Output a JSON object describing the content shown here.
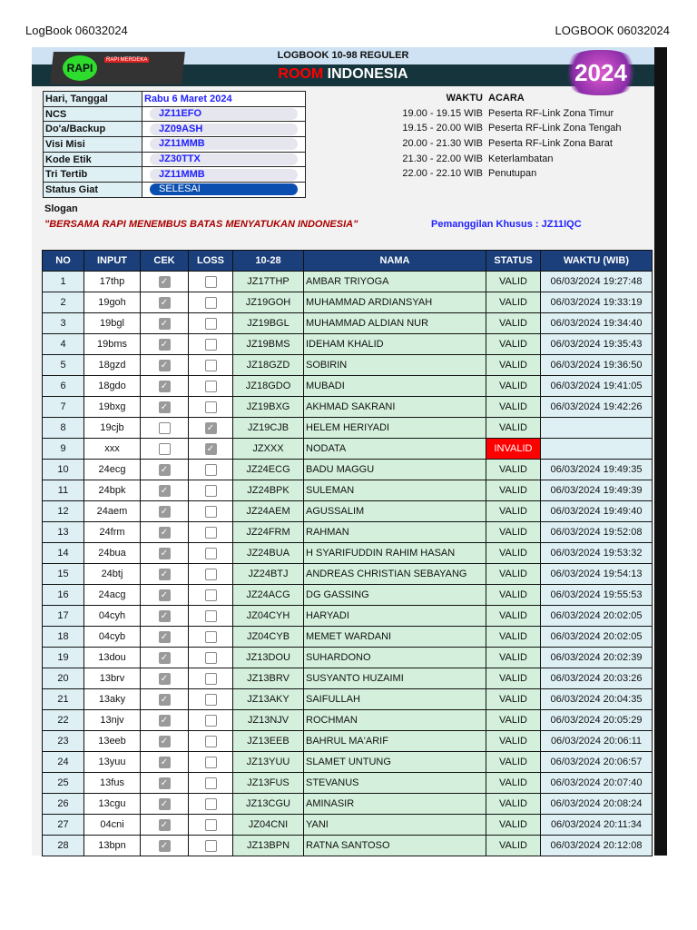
{
  "page_header": {
    "left": "LogBook 06032024",
    "right": "LOGBOOK 06032024"
  },
  "banner": {
    "title": "LOGBOOK 10-98 REGULER",
    "room_red": "ROOM",
    "room_white": "INDONESIA",
    "logo_text": "RAPI",
    "logo_sub": "RAPI MERDEKA",
    "year_badge": "2024"
  },
  "info": [
    {
      "label": "Hari, Tanggal",
      "value": "Rabu 6 Maret 2024"
    },
    {
      "label": "NCS",
      "value": "JZ11EFO"
    },
    {
      "label": "Do'a/Backup",
      "value": "JZ09ASH"
    },
    {
      "label": "Visi Misi",
      "value": "JZ11MMB"
    },
    {
      "label": "Kode Etik",
      "value": "JZ30TTX"
    },
    {
      "label": "Tri Tertib",
      "value": "JZ11MMB"
    },
    {
      "label": "Status Giat",
      "value": "SELESAI"
    }
  ],
  "schedule": {
    "header_time": "WAKTU",
    "header_event": "ACARA",
    "items": [
      {
        "time": "19.00 - 19.15 WIB",
        "event": "Peserta RF-Link Zona Timur"
      },
      {
        "time": "19.15 - 20.00 WIB",
        "event": "Peserta RF-Link Zona Tengah"
      },
      {
        "time": "20.00 - 21.30 WIB",
        "event": "Peserta RF-Link Zona Barat"
      },
      {
        "time": "21.30 - 22.00 WIB",
        "event": "Keterlambatan"
      },
      {
        "time": "22.00 - 22.10 WIB",
        "event": "Penutupan"
      }
    ]
  },
  "slogan": {
    "label": "Slogan",
    "text": "\"BERSAMA RAPI MENEMBUS BATAS MENYATUKAN INDONESIA\"",
    "special_call": "Pemanggilan Khusus   :  JZ11IQC"
  },
  "colors": {
    "header": "#1a3f7a",
    "invalid": "#ff0000",
    "green": "#d4f0dc"
  },
  "table": {
    "headers": [
      "NO",
      "INPUT",
      "CEK",
      "LOSS",
      "10-28",
      "NAMA",
      "STATUS",
      "WAKTU (WIB)"
    ],
    "rows": [
      [
        "1",
        "17thp",
        true,
        false,
        "JZ17THP",
        "AMBAR TRIYOGA",
        "VALID",
        "06/03/2024 19:27:48"
      ],
      [
        "2",
        "19goh",
        true,
        false,
        "JZ19GOH",
        "MUHAMMAD ARDIANSYAH",
        "VALID",
        "06/03/2024 19:33:19"
      ],
      [
        "3",
        "19bgl",
        true,
        false,
        "JZ19BGL",
        "MUHAMMAD ALDIAN NUR",
        "VALID",
        "06/03/2024 19:34:40"
      ],
      [
        "4",
        "19bms",
        true,
        false,
        "JZ19BMS",
        "IDEHAM KHALID",
        "VALID",
        "06/03/2024 19:35:43"
      ],
      [
        "5",
        "18gzd",
        true,
        false,
        "JZ18GZD",
        "SOBIRIN",
        "VALID",
        "06/03/2024 19:36:50"
      ],
      [
        "6",
        "18gdo",
        true,
        false,
        "JZ18GDO",
        "MUBADI",
        "VALID",
        "06/03/2024 19:41:05"
      ],
      [
        "7",
        "19bxg",
        true,
        false,
        "JZ19BXG",
        "AKHMAD SAKRANI",
        "VALID",
        "06/03/2024 19:42:26"
      ],
      [
        "8",
        "19cjb",
        false,
        true,
        "JZ19CJB",
        "HELEM HERIYADI",
        "VALID",
        ""
      ],
      [
        "9",
        "xxx",
        false,
        true,
        "JZXXX",
        "NODATA",
        "INVALID",
        ""
      ],
      [
        "10",
        "24ecg",
        true,
        false,
        "JZ24ECG",
        "BADU MAGGU",
        "VALID",
        "06/03/2024 19:49:35"
      ],
      [
        "11",
        "24bpk",
        true,
        false,
        "JZ24BPK",
        "SULEMAN",
        "VALID",
        "06/03/2024 19:49:39"
      ],
      [
        "12",
        "24aem",
        true,
        false,
        "JZ24AEM",
        "AGUSSALIM",
        "VALID",
        "06/03/2024 19:49:40"
      ],
      [
        "13",
        "24frm",
        true,
        false,
        "JZ24FRM",
        "RAHMAN",
        "VALID",
        "06/03/2024 19:52:08"
      ],
      [
        "14",
        "24bua",
        true,
        false,
        "JZ24BUA",
        "H SYARIFUDDIN RAHIM HASAN",
        "VALID",
        "06/03/2024 19:53:32"
      ],
      [
        "15",
        "24btj",
        true,
        false,
        "JZ24BTJ",
        "ANDREAS CHRISTIAN SEBAYANG",
        "VALID",
        "06/03/2024 19:54:13"
      ],
      [
        "16",
        "24acg",
        true,
        false,
        "JZ24ACG",
        "DG GASSING",
        "VALID",
        "06/03/2024 19:55:53"
      ],
      [
        "17",
        "04cyh",
        true,
        false,
        "JZ04CYH",
        "HARYADI",
        "VALID",
        "06/03/2024 20:02:05"
      ],
      [
        "18",
        "04cyb",
        true,
        false,
        "JZ04CYB",
        "MEMET WARDANI",
        "VALID",
        "06/03/2024 20:02:05"
      ],
      [
        "19",
        "13dou",
        true,
        false,
        "JZ13DOU",
        "SUHARDONO",
        "VALID",
        "06/03/2024 20:02:39"
      ],
      [
        "20",
        "13brv",
        true,
        false,
        "JZ13BRV",
        "SUSYANTO HUZAIMI",
        "VALID",
        "06/03/2024 20:03:26"
      ],
      [
        "21",
        "13aky",
        true,
        false,
        "JZ13AKY",
        "SAIFULLAH",
        "VALID",
        "06/03/2024 20:04:35"
      ],
      [
        "22",
        "13njv",
        true,
        false,
        "JZ13NJV",
        "ROCHMAN",
        "VALID",
        "06/03/2024 20:05:29"
      ],
      [
        "23",
        "13eeb",
        true,
        false,
        "JZ13EEB",
        "BAHRUL MA'ARIF",
        "VALID",
        "06/03/2024 20:06:11"
      ],
      [
        "24",
        "13yuu",
        true,
        false,
        "JZ13YUU",
        "SLAMET UNTUNG",
        "VALID",
        "06/03/2024 20:06:57"
      ],
      [
        "25",
        "13fus",
        true,
        false,
        "JZ13FUS",
        "STEVANUS",
        "VALID",
        "06/03/2024 20:07:40"
      ],
      [
        "26",
        "13cgu",
        true,
        false,
        "JZ13CGU",
        "AMINASIR",
        "VALID",
        "06/03/2024 20:08:24"
      ],
      [
        "27",
        "04cni",
        true,
        false,
        "JZ04CNI",
        "YANI",
        "VALID",
        "06/03/2024 20:11:34"
      ],
      [
        "28",
        "13bpn",
        true,
        false,
        "JZ13BPN",
        "RATNA SANTOSO",
        "VALID",
        "06/03/2024 20:12:08"
      ]
    ]
  }
}
